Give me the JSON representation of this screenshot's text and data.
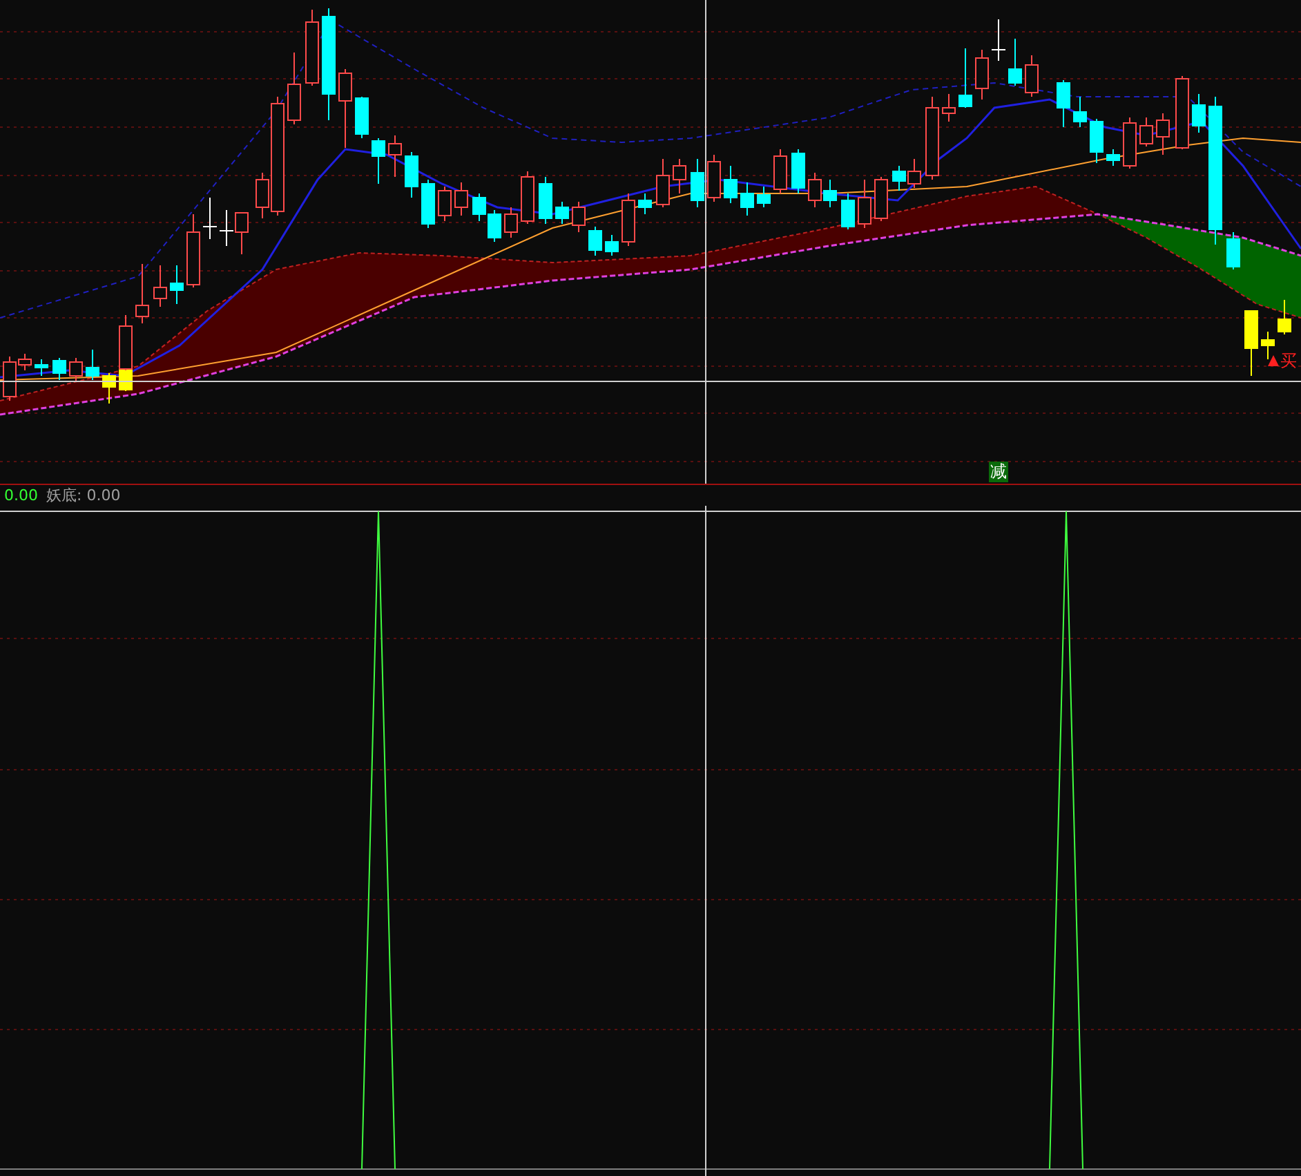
{
  "main_chart": {
    "markers": [
      {
        "kind": "badge",
        "text": "减"
      },
      {
        "kind": "arrow",
        "text": "买"
      }
    ]
  },
  "legend": {
    "value": "0.00",
    "indicator": "妖底: 0.00"
  }
}
